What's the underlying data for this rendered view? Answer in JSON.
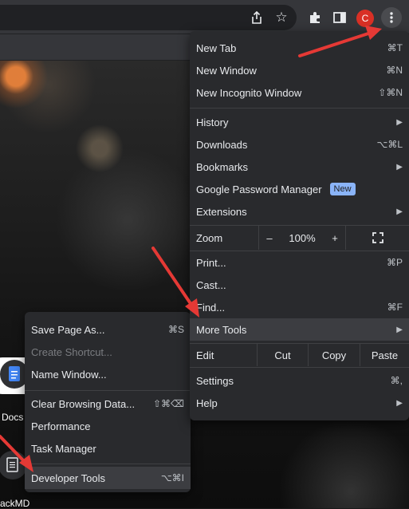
{
  "browser": {
    "avatar_letter": "C",
    "icons": [
      "share-icon",
      "star-icon",
      "extensions-icon",
      "side-panel-icon",
      "kebab-icon"
    ]
  },
  "page": {
    "shortcuts": [
      {
        "label": "Docs"
      },
      {
        "label": "ackMD"
      }
    ]
  },
  "main_menu": {
    "new_tab": {
      "label": "New Tab",
      "shortcut": "⌘T"
    },
    "new_window": {
      "label": "New Window",
      "shortcut": "⌘N"
    },
    "new_incognito": {
      "label": "New Incognito Window",
      "shortcut": "⇧⌘N"
    },
    "history": {
      "label": "History"
    },
    "downloads": {
      "label": "Downloads",
      "shortcut": "⌥⌘L"
    },
    "bookmarks": {
      "label": "Bookmarks"
    },
    "password_manager": {
      "label": "Google Password Manager",
      "badge": "New"
    },
    "extensions": {
      "label": "Extensions"
    },
    "zoom": {
      "label": "Zoom",
      "minus": "–",
      "value": "100%",
      "plus": "+"
    },
    "print": {
      "label": "Print...",
      "shortcut": "⌘P"
    },
    "cast": {
      "label": "Cast..."
    },
    "find": {
      "label": "Find...",
      "shortcut": "⌘F"
    },
    "more_tools": {
      "label": "More Tools"
    },
    "edit": {
      "label": "Edit",
      "cut": "Cut",
      "copy": "Copy",
      "paste": "Paste"
    },
    "settings": {
      "label": "Settings",
      "shortcut": "⌘,"
    },
    "help": {
      "label": "Help"
    }
  },
  "sub_menu": {
    "save_page": {
      "label": "Save Page As...",
      "shortcut": "⌘S"
    },
    "create_shortcut": {
      "label": "Create Shortcut..."
    },
    "name_window": {
      "label": "Name Window..."
    },
    "clear_browsing": {
      "label": "Clear Browsing Data...",
      "shortcut": "⇧⌘⌫"
    },
    "performance": {
      "label": "Performance"
    },
    "task_manager": {
      "label": "Task Manager"
    },
    "developer_tools": {
      "label": "Developer Tools",
      "shortcut": "⌥⌘I"
    }
  },
  "colors": {
    "menu_bg": "#292a2d",
    "highlight": "#3c3d41",
    "arrow": "#e53935",
    "badge": "#8ab4f8",
    "avatar": "#d93025"
  }
}
